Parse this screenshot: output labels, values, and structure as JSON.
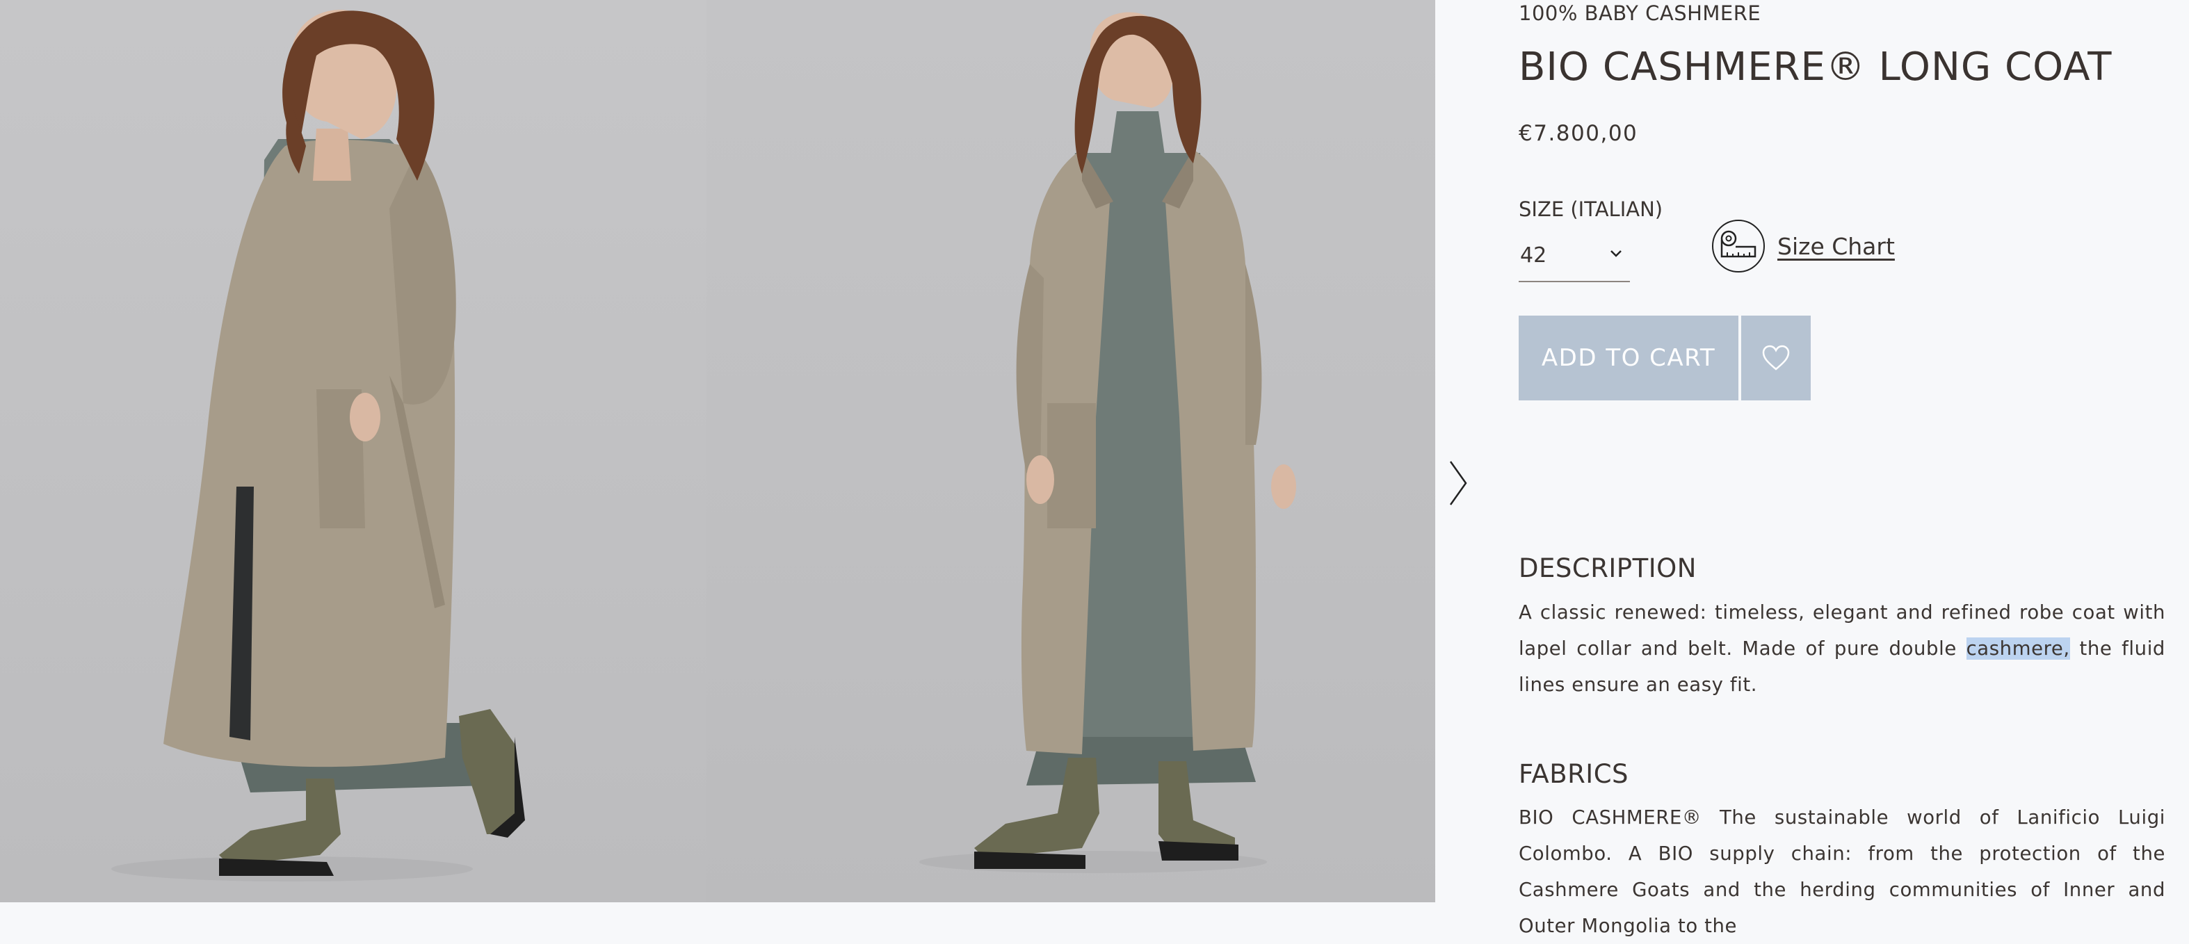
{
  "product": {
    "kicker": "100% BABY CASHMERE",
    "name": "BIO CASHMERE® LONG COAT",
    "price": "€7.800,00",
    "size_label": "SIZE (ITALIAN)",
    "size_value": "42",
    "size_chart_label": "Size Chart",
    "add_to_cart_label": "ADD TO CART"
  },
  "description": {
    "title": "DESCRIPTION",
    "text_before": "A classic renewed: timeless, elegant and refined robe coat with lapel collar and belt. Made of pure double ",
    "text_highlight": "cashmere,",
    "text_after": " the fluid lines ensure an easy fit."
  },
  "fabrics": {
    "title": "FABRICS",
    "text": "BIO CASHMERE® The sustainable world of Lanificio Luigi Colombo. A BIO supply chain: from the protection of the Cashmere Goats and the herding communities of Inner and Outer Mongolia to the"
  },
  "colors": {
    "button_bg": "#b6c3d2",
    "panel_bg": "#f7f8fa",
    "selection_highlight": "#bcd3f0",
    "text": "#3b3532"
  },
  "icons": {
    "gallery_next": "chevron-right-icon",
    "size_select": "chevron-down-icon",
    "size_chart": "measuring-tape-icon",
    "wishlist": "heart-icon"
  }
}
